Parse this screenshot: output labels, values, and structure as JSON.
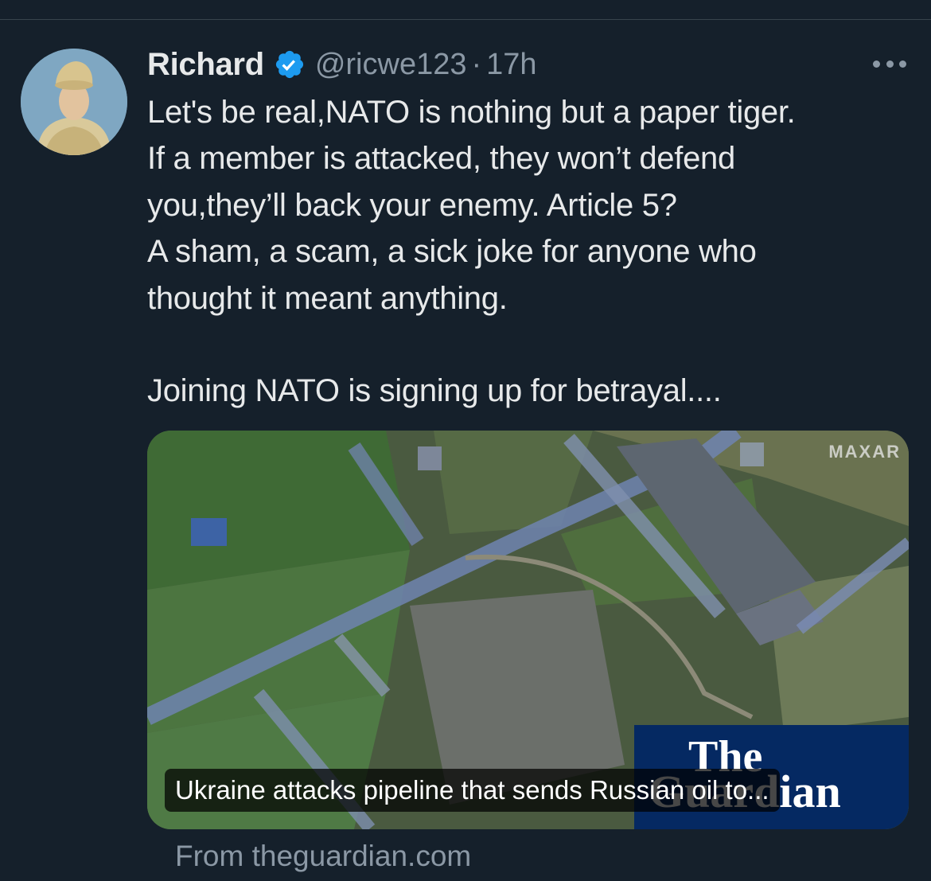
{
  "tweet": {
    "author_name": "Richard",
    "handle": "@ricwe123",
    "separator": "·",
    "time": "17h",
    "lines": [
      "Let's be real,NATO is nothing but a paper tiger.",
      "If a member is attacked, they won’t defend",
      "you,they’ll back your enemy. Article 5?",
      "A sham, a scam, a sick joke for anyone who",
      "thought it meant anything.",
      "",
      "Joining NATO is signing up for betrayal...."
    ],
    "icons": {
      "verified": "verified-badge-icon",
      "more": "more-options-icon"
    }
  },
  "card": {
    "image_watermark": "MAXAR",
    "logo_line1": "The",
    "logo_line2": "Guardian",
    "headline": "Ukraine attacks pipeline that sends Russian oil to...",
    "source": "From theguardian.com"
  },
  "colors": {
    "background": "#15202b",
    "text_primary": "#e7e9ea",
    "text_secondary": "#8b98a5",
    "verified_blue": "#1d9bf0",
    "guardian_blue": "#052962"
  }
}
